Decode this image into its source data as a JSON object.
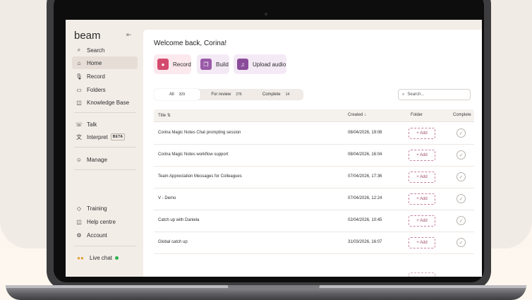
{
  "sidebar": {
    "brand": "beam",
    "collapse_icon": "collapse-sidebar-icon",
    "items_top": [
      {
        "label": "Search",
        "icon": "search-icon"
      },
      {
        "label": "Home",
        "icon": "home-icon"
      },
      {
        "label": "Record",
        "icon": "microphone-icon"
      },
      {
        "label": "Folders",
        "icon": "folder-icon"
      },
      {
        "label": "Knowledge Base",
        "icon": "book-icon"
      }
    ],
    "items_mid": [
      {
        "label": "Talk",
        "icon": "chat-icon"
      },
      {
        "label": "Interpret",
        "icon": "translate-icon",
        "badge": "BETA"
      }
    ],
    "manage": {
      "label": "Manage",
      "icon": "users-icon"
    },
    "items_bottom": [
      {
        "label": "Training",
        "icon": "graduation-cap-icon"
      },
      {
        "label": "Help centre",
        "icon": "book-icon"
      },
      {
        "label": "Account",
        "icon": "gear-icon"
      }
    ],
    "live_chat": {
      "label": "Live chat",
      "status_color": "#2fb24f"
    }
  },
  "main": {
    "welcome": "Welcome back, Corina!",
    "actions": [
      {
        "label": "Record",
        "icon": "microphone-icon",
        "color": "#d44a6f"
      },
      {
        "label": "Build",
        "icon": "copy-icon",
        "color": "#9a5aa8"
      },
      {
        "label": "Upload audio",
        "icon": "audio-wave-icon",
        "color": "#8a4c9a"
      }
    ],
    "filters": [
      {
        "label": "All",
        "count": "329"
      },
      {
        "label": "For review",
        "count": "276"
      },
      {
        "label": "Complete",
        "count": "14"
      }
    ],
    "search_placeholder": "Search...",
    "columns": {
      "title": "Title ⇅",
      "created": "Created ↓",
      "folder": "Folder",
      "complete": "Complete"
    },
    "rows": [
      {
        "title": "Corina Magic Notes Chat prompting session",
        "created": "08/04/2026, 19:08",
        "folder_action": "+ Add"
      },
      {
        "title": "Corina Magic Notes workflow support",
        "created": "08/04/2026, 16:04",
        "folder_action": "+ Add"
      },
      {
        "title": "Team Appreciation Messages for Colleagues",
        "created": "07/04/2026, 17:36",
        "folder_action": "+ Add"
      },
      {
        "title": "V - Demo",
        "created": "07/04/2026, 12:24",
        "folder_action": "+ Add"
      },
      {
        "title": "Catch up with Daniela",
        "created": "02/04/2026, 10:45",
        "folder_action": "+ Add"
      },
      {
        "title": "Global catch up",
        "created": "31/03/2026, 16:07",
        "folder_action": "+ Add"
      }
    ]
  }
}
